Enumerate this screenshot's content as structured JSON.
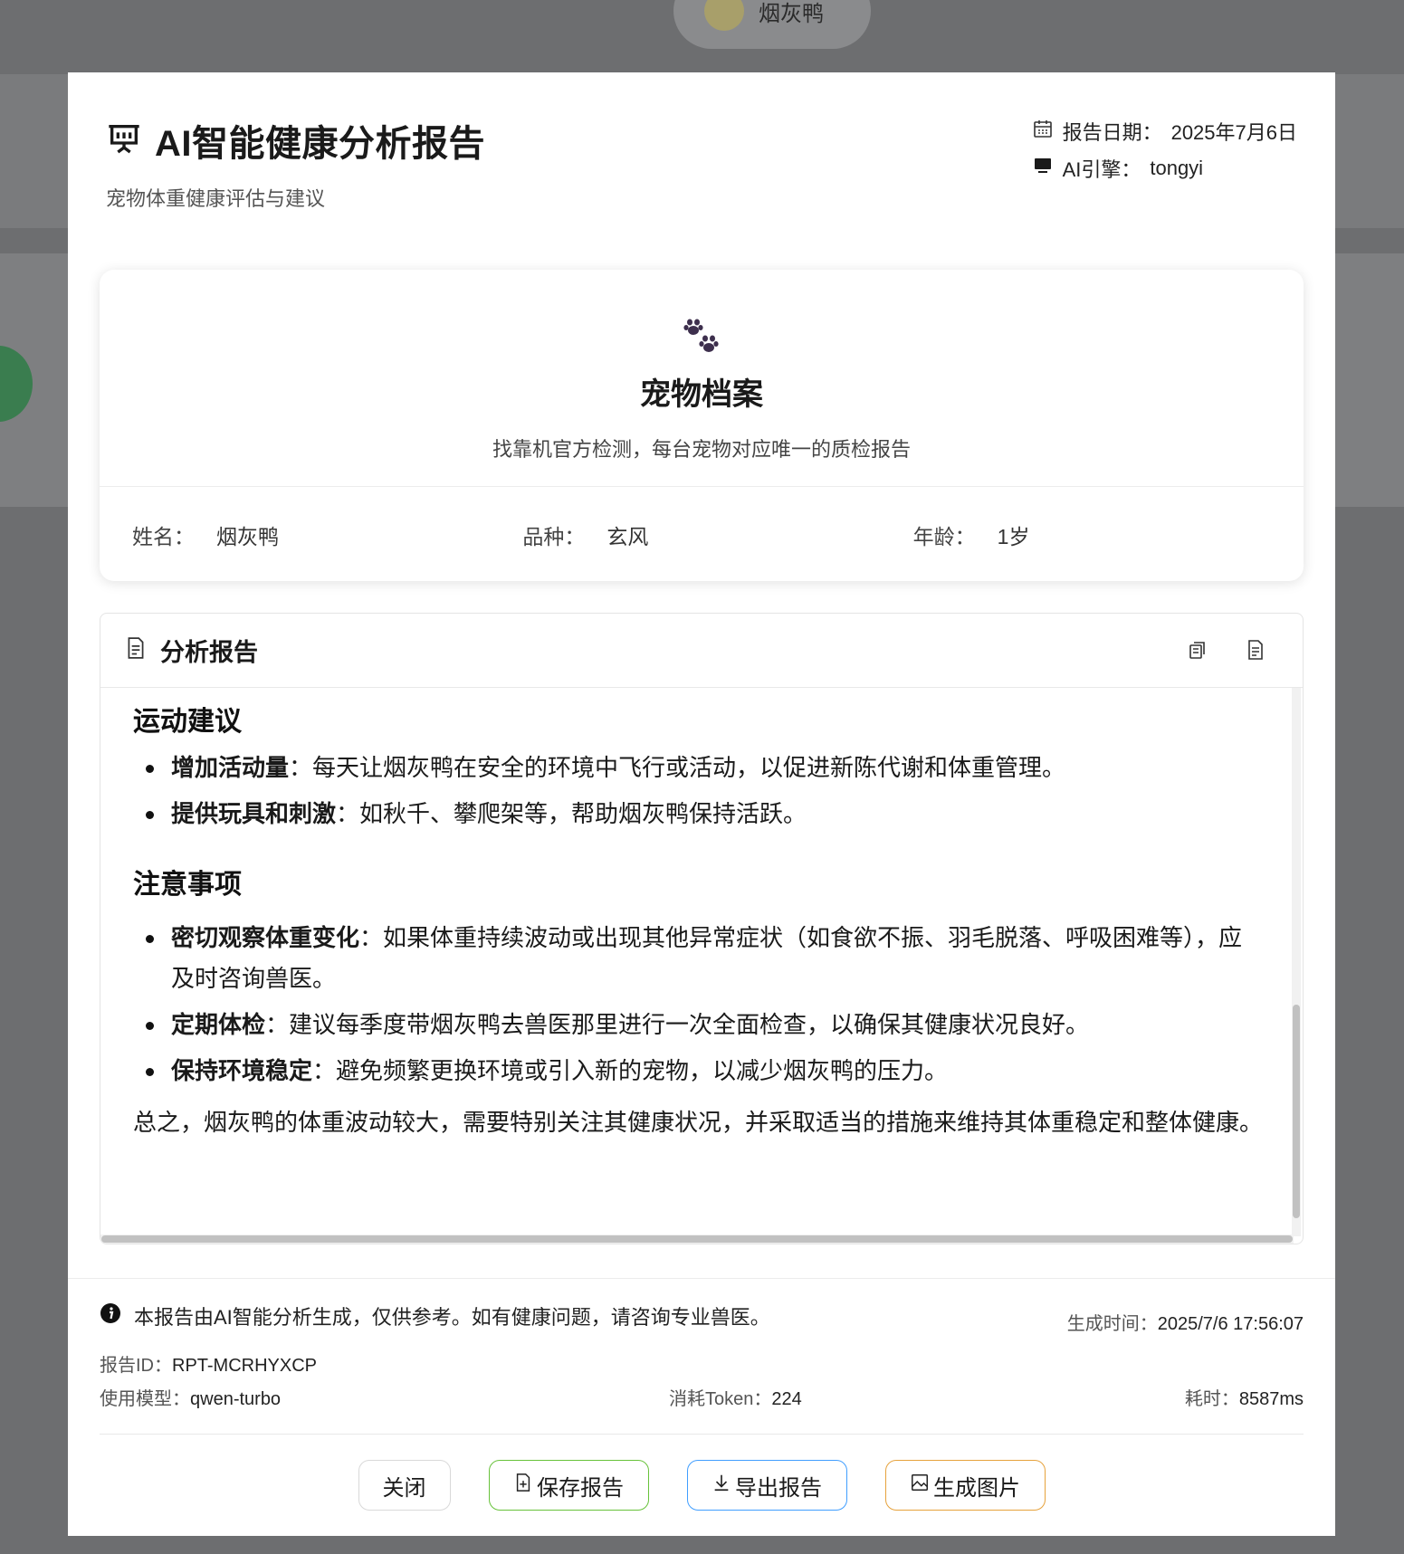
{
  "background": {
    "pill_name": "烟灰鸭"
  },
  "header": {
    "title": "AI智能健康分析报告",
    "subtitle": "宠物体重健康评估与建议",
    "date_label": "报告日期：",
    "date_value": "2025年7月6日",
    "engine_label": "AI引擎：",
    "engine_value": "tongyi"
  },
  "pet_profile": {
    "title": "宠物档案",
    "description": "找靠机官方检测，每台宠物对应唯一的质检报告",
    "fields": [
      {
        "label": "姓名：",
        "value": "烟灰鸭"
      },
      {
        "label": "品种：",
        "value": "玄风"
      },
      {
        "label": "年龄：",
        "value": "1岁"
      }
    ]
  },
  "report": {
    "title": "分析报告",
    "sections": [
      {
        "heading": "运动建议",
        "items": [
          {
            "bold": "增加活动量",
            "text": "：每天让烟灰鸭在安全的环境中飞行或活动，以促进新陈代谢和体重管理。"
          },
          {
            "bold": "提供玩具和刺激",
            "text": "：如秋千、攀爬架等，帮助烟灰鸭保持活跃。"
          }
        ]
      },
      {
        "heading": "注意事项",
        "items": [
          {
            "bold": "密切观察体重变化",
            "text": "：如果体重持续波动或出现其他异常症状（如食欲不振、羽毛脱落、呼吸困难等），应及时咨询兽医。"
          },
          {
            "bold": "定期体检",
            "text": "：建议每季度带烟灰鸭去兽医那里进行一次全面检查，以确保其健康状况良好。"
          },
          {
            "bold": "保持环境稳定",
            "text": "：避免频繁更换环境或引入新的宠物，以减少烟灰鸭的压力。"
          }
        ]
      }
    ],
    "conclusion": "总之，烟灰鸭的体重波动较大，需要特别关注其健康状况，并采取适当的措施来维持其体重稳定和整体健康。"
  },
  "footer": {
    "notice": "本报告由AI智能分析生成，仅供参考。如有健康问题，请咨询专业兽医。",
    "gen_time_label": "生成时间：",
    "gen_time_value": "2025/7/6 17:56:07",
    "report_id_label": "报告ID：",
    "report_id_value": "RPT-MCRHYXCP",
    "model_label": "使用模型：",
    "model_value": "qwen-turbo",
    "token_label": "消耗Token：",
    "token_value": "224",
    "duration_label": "耗时：",
    "duration_value": "8587ms"
  },
  "buttons": {
    "close": "关闭",
    "save": "保存报告",
    "export": "导出报告",
    "image": "生成图片"
  },
  "colors": {
    "save_border": "#67c23a",
    "export_border": "#409eff",
    "image_border": "#e6a23c"
  }
}
